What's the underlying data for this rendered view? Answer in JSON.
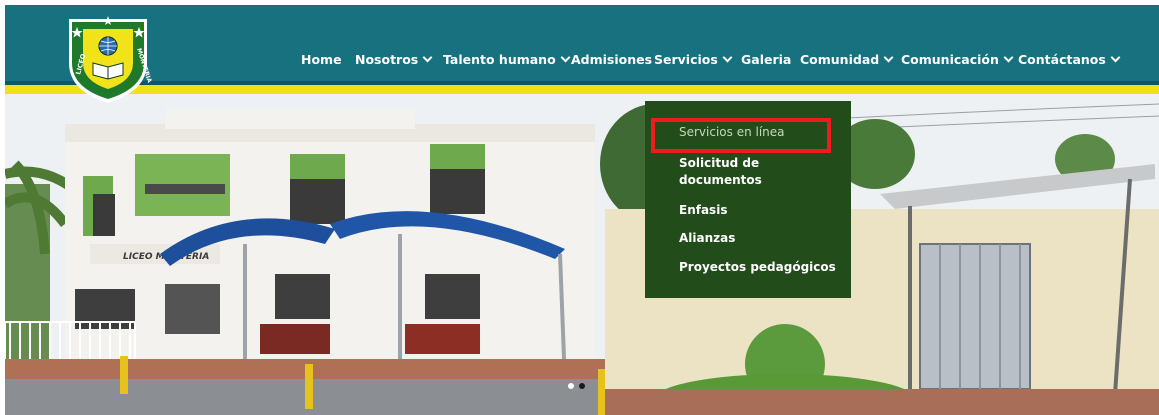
{
  "logo": {
    "text_left": "LICEO",
    "text_right": "MONTERIA",
    "colors": {
      "shield_green": "#1e7a2a",
      "shield_yellow": "#f2e21a",
      "stars": "#ffffff"
    }
  },
  "nav": {
    "items": [
      {
        "label": "Home",
        "has_dropdown": false
      },
      {
        "label": "Nosotros",
        "has_dropdown": true
      },
      {
        "label": "Talento humano",
        "has_dropdown": true
      },
      {
        "label": "Admisiones",
        "has_dropdown": false
      },
      {
        "label": "Servicios",
        "has_dropdown": true
      },
      {
        "label": "Galeria",
        "has_dropdown": false
      },
      {
        "label": "Comunidad",
        "has_dropdown": true
      },
      {
        "label": "Comunicación",
        "has_dropdown": true
      },
      {
        "label": "Contáctanos",
        "has_dropdown": true
      }
    ]
  },
  "servicios_menu": {
    "items": [
      {
        "label": "Servicios en línea",
        "highlighted": true
      },
      {
        "label": "Solicitud de documentos",
        "highlighted": false
      },
      {
        "label": "Enfasis",
        "highlighted": false
      },
      {
        "label": "Alianzas",
        "highlighted": false
      },
      {
        "label": "Proyectos pedagógicos",
        "highlighted": false
      }
    ]
  },
  "hero": {
    "building_sign": "LICEO MONTERIA"
  },
  "colors": {
    "header_teal": "#17717e",
    "header_yellow": "#efe01a",
    "dropdown_bg": "#224d1a",
    "highlight_red": "#ee1c1c",
    "canopy_blue": "#1e4f9c"
  },
  "slider": {
    "total": 2,
    "active_index": 0
  }
}
